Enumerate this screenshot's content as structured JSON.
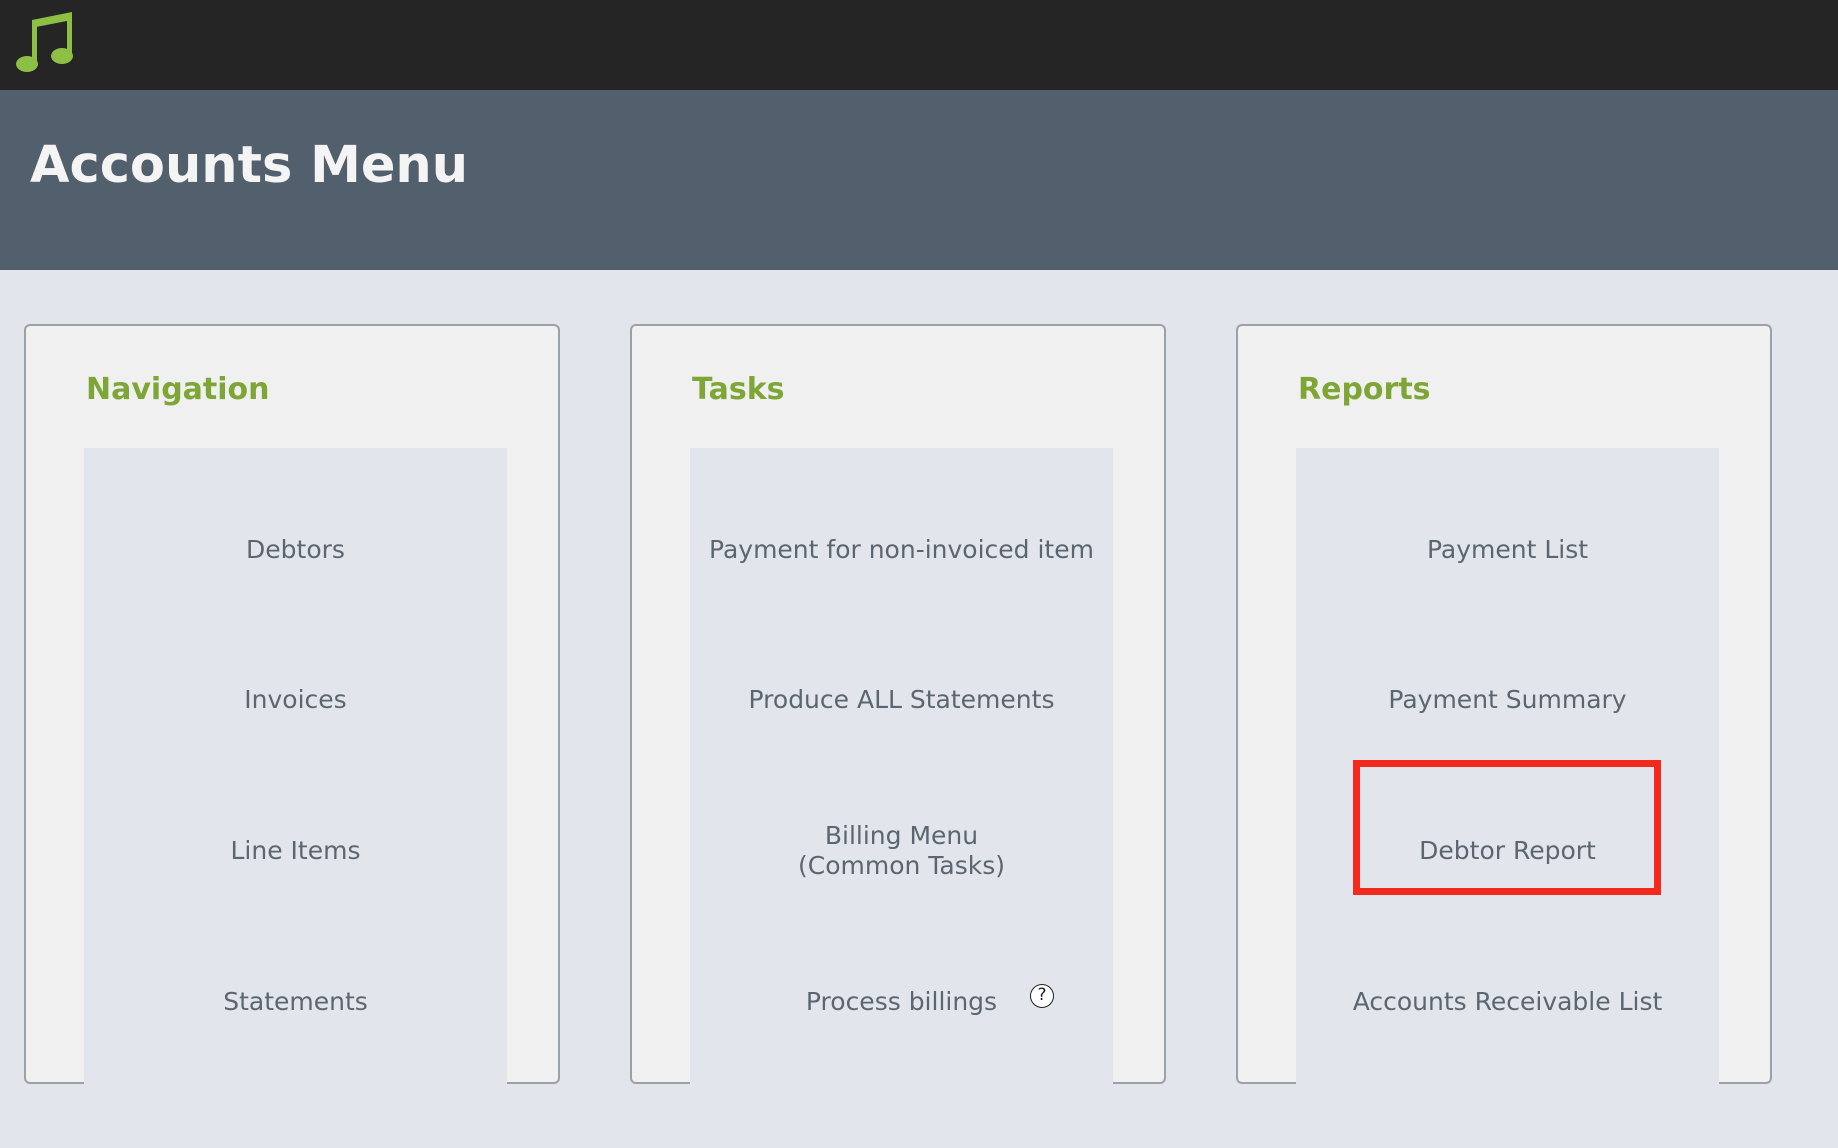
{
  "app": {
    "logo_icon": "music-note-icon",
    "accent": "#7ea636"
  },
  "header": {
    "title": "Accounts Menu"
  },
  "panels": {
    "navigation": {
      "title": "Navigation",
      "items": [
        "Debtors",
        "Invoices",
        "Line Items",
        "Statements"
      ]
    },
    "tasks": {
      "title": "Tasks",
      "items": [
        "Payment for non-invoiced item",
        "Produce ALL Statements",
        "Billing Menu",
        "(Common Tasks)",
        "Process billings"
      ],
      "help_icon": "?"
    },
    "reports": {
      "title": "Reports",
      "items": [
        "Payment List",
        "Payment Summary",
        "Debtor Report",
        "Accounts Receivable List"
      ]
    }
  },
  "highlight_color": "#f2291c"
}
